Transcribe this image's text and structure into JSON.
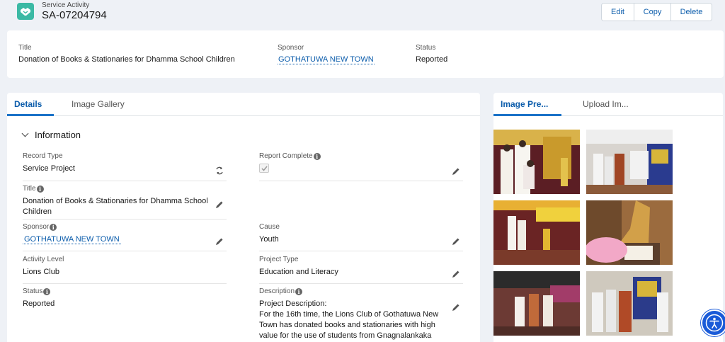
{
  "header": {
    "object_type": "Service Activity",
    "record_name": "SA-07204794",
    "actions": {
      "edit": "Edit",
      "copy": "Copy",
      "delete": "Delete"
    }
  },
  "highlights": {
    "title_label": "Title",
    "title_value": "Donation of Books & Stationaries for Dhamma School Children",
    "sponsor_label": "Sponsor",
    "sponsor_value": "GOTHATUWA NEW TOWN",
    "status_label": "Status",
    "status_value": "Reported"
  },
  "main_tabs": {
    "details": "Details",
    "gallery": "Image Gallery"
  },
  "section": {
    "title": "Information"
  },
  "fields": {
    "record_type": {
      "label": "Record Type",
      "value": "Service Project"
    },
    "report_complete": {
      "label": "Report Complete",
      "checked": true
    },
    "title": {
      "label": "Title",
      "value": "Donation of Books & Stationaries for Dhamma School Children"
    },
    "sponsor": {
      "label": "Sponsor",
      "value": "GOTHATUWA NEW TOWN"
    },
    "cause": {
      "label": "Cause",
      "value": "Youth"
    },
    "activity_level": {
      "label": "Activity Level",
      "value": "Lions Club"
    },
    "project_type": {
      "label": "Project Type",
      "value": "Education and Literacy"
    },
    "status": {
      "label": "Status",
      "value": "Reported"
    },
    "description": {
      "label": "Description",
      "value": "Project Description:\nFor the 16th time, the Lions Club of Gothatuwa New Town has donated books and stationaries with high value for the use of students from Gnagnalankaka"
    }
  },
  "side_tabs": {
    "preview": "Image Pre...",
    "upload": "Upload Im..."
  },
  "colors": {
    "accent": "#0b5cab",
    "tab_underline": "#1b72c8",
    "brand_icon": "#3bb9a4",
    "a11y_button": "#1a5bd8"
  },
  "icons": {
    "header": "handshake-icon",
    "edit": "pencil-icon",
    "record_type_change": "change-record-type-icon",
    "accessibility": "accessibility-icon"
  }
}
